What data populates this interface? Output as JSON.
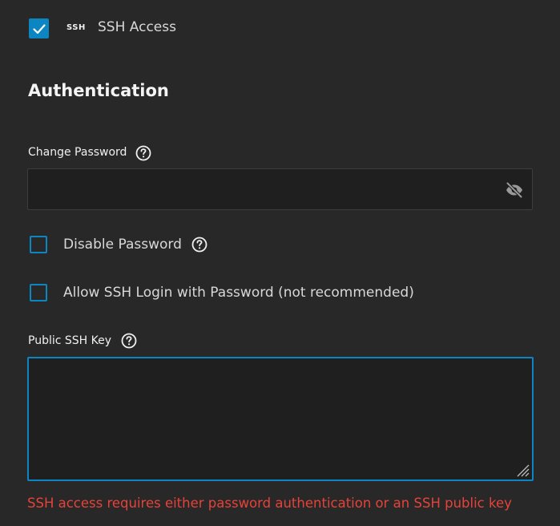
{
  "ssh_access": {
    "checked": true,
    "badge": "SSH",
    "label": "SSH Access"
  },
  "section": {
    "title": "Authentication"
  },
  "change_password": {
    "label": "Change Password",
    "value": "",
    "placeholder": ""
  },
  "disable_password": {
    "label": "Disable Password",
    "checked": false
  },
  "allow_ssh_password": {
    "label": "Allow SSH Login with Password (not recommended)",
    "checked": false
  },
  "public_key": {
    "label": "Public SSH Key",
    "value": ""
  },
  "error": {
    "message": "SSH access requires either password authentication or an SSH public key"
  },
  "colors": {
    "accent": "#0b86c2",
    "error": "#e5433a",
    "background": "#282828",
    "input_bg": "#1f1f1f"
  },
  "icons": {
    "help": "help-circle-icon",
    "visibility": "eye-off-icon",
    "check": "check-icon",
    "resize": "resize-handle-icon"
  }
}
